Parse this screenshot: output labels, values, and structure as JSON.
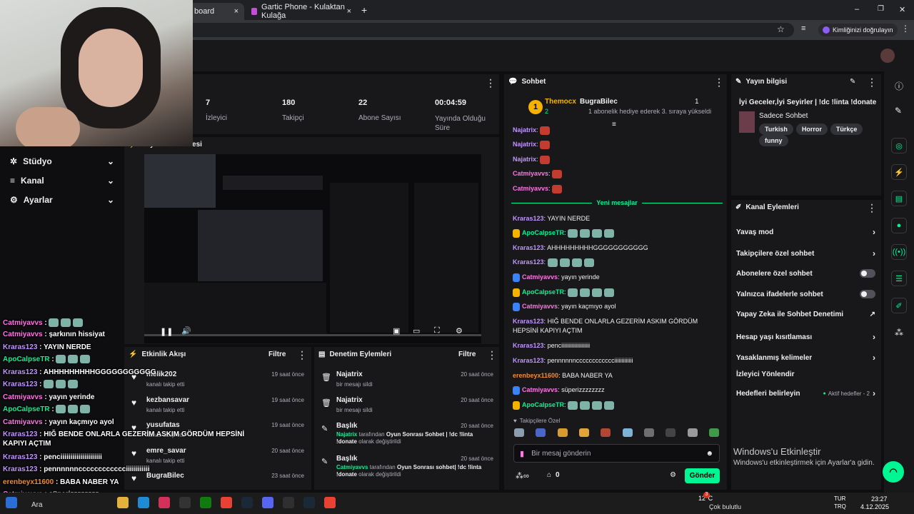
{
  "browser": {
    "tabs": [
      {
        "label": "board",
        "close": "×"
      },
      {
        "label": "Gartic Phone - Kulaktan Kulağa",
        "close": "×"
      }
    ],
    "new_tab": "+",
    "profile_label": "Kimliğinizi doğrulayın",
    "win_min": "–",
    "win_max": "❐",
    "win_close": "✕"
  },
  "stats": [
    {
      "value": "7",
      "label": "İzleyici"
    },
    {
      "value": "180",
      "label": "Takipçi"
    },
    {
      "value": "22",
      "label": "Abone Sayısı"
    },
    {
      "value": "00:04:59",
      "label": "Yayında Olduğu Süre"
    }
  ],
  "preview_title": "Yayın Ön İzlemesi",
  "sidebar": {
    "items": [
      {
        "label": "Stüdyo"
      },
      {
        "label": "Kanal"
      },
      {
        "label": "Ayarlar"
      }
    ]
  },
  "activity": {
    "title": "Etkinlik Akışı",
    "filter": "Filtre",
    "items": [
      {
        "name": "melik202",
        "action": "kanalı takip etti",
        "time": "19 saat önce"
      },
      {
        "name": "kezbansavar",
        "action": "kanalı takip etti",
        "time": "19 saat önce"
      },
      {
        "name": "yusufatas",
        "action": "kanalı takip etti",
        "time": "19 saat önce"
      },
      {
        "name": "emre_savar",
        "action": "kanalı takip etti",
        "time": "20 saat önce"
      },
      {
        "name": "BugraBilec",
        "action": "",
        "time": "23 saat önce"
      }
    ]
  },
  "moderation": {
    "title": "Denetim Eylemleri",
    "filter": "Filtre",
    "items": [
      {
        "name": "Najatrix",
        "detail": "bir mesajı sildi",
        "time": "20 saat önce"
      },
      {
        "name": "Najatrix",
        "detail": "bir mesajı sildi",
        "time": "20 saat önce"
      },
      {
        "name": "Başlık",
        "user": "Najatrix",
        "mid": "tarafından",
        "value": "Oyun Sonrası Sohbet | !dc !linta !donate",
        "tail": "olarak değiştirildi",
        "time": "20 saat önce"
      },
      {
        "name": "Başlık",
        "user": "Catmiyavvs",
        "mid": "tarafından",
        "value": "Oyun Sonrası sohbet| !dc !linta !donate",
        "tail": "olarak değiştirildi",
        "time": "20 saat önce"
      }
    ]
  },
  "chat": {
    "title": "Sohbet",
    "leader": {
      "rank": "1",
      "name": "Themocx",
      "count": "2"
    },
    "gift": {
      "name": "BugraBilec",
      "count": "1",
      "text": "1 abonelik hediye ederek 3. sıraya yükseldi"
    },
    "new_messages": "Yeni mesajlar",
    "messages_before": [
      {
        "user": "Najatrix",
        "text": ""
      },
      {
        "user": "Najatrix",
        "text": ""
      },
      {
        "user": "Najatrix",
        "text": ""
      },
      {
        "user": "Catmiyavvs",
        "text": ""
      },
      {
        "user": "Catmiyavvs",
        "text": ""
      }
    ],
    "messages": [
      {
        "user": "Kraras123",
        "text": "YAYIN NERDE"
      },
      {
        "user": "ApoCalpseTR",
        "text": ""
      },
      {
        "user": "Kraras123",
        "text": "AHHHHHHHHHGGGGGGGGGGG"
      },
      {
        "user": "Kraras123",
        "text": ""
      },
      {
        "user": "Catmiyavvs",
        "text": "yayın yerinde"
      },
      {
        "user": "ApoCalpseTR",
        "text": ""
      },
      {
        "user": "Catmiyavvs",
        "text": "yayın kaçmıyo ayol"
      },
      {
        "user": "Kraras123",
        "text": "HIĞ BENDE ONLARLA GEZERİM ASKIM GÖRDÜM HEPSİNİ KAPIYI AÇTIM"
      },
      {
        "user": "Kraras123",
        "text": "penciiiiiiiiiiiiiiiiiiii"
      },
      {
        "user": "Kraras123",
        "text": "pennnnnncccccccccccciiiiiiiiiiiii"
      },
      {
        "user": "erenbeyx11600",
        "text": "BABA NABER YA"
      },
      {
        "user": "Catmiyavvs",
        "text": "süperizzzzzzzz"
      },
      {
        "user": "ApoCalpseTR",
        "text": ""
      }
    ],
    "emote_section": "Takipçilere Özel",
    "input_placeholder": "Bir mesaj gönderin",
    "points": "0",
    "send": "Gönder"
  },
  "stream_info": {
    "title": "Yayın bilgisi",
    "stream_title": "İyi Geceler,İyi Seyirler | !dc !linta !donate",
    "category": "Sadece Sohbet",
    "tags": [
      "Turkish",
      "Horror",
      "Türkçe",
      "funny"
    ]
  },
  "channel_actions": {
    "title": "Kanal Eylemleri",
    "items": [
      {
        "label": "Yavaş mod",
        "control": "chevron"
      },
      {
        "label": "Takipçilere özel sohbet",
        "control": "chevron"
      },
      {
        "label": "Abonelere özel sohbet",
        "control": "toggle"
      },
      {
        "label": "Yalnızca ifadelerle sohbet",
        "control": "toggle"
      },
      {
        "label": "Yapay Zeka ile Sohbet Denetimi",
        "control": "external"
      },
      {
        "label": "Hesap yaşı kısıtlaması",
        "control": "chevron"
      },
      {
        "label": "Yasaklanmış kelimeler",
        "control": "chevron"
      },
      {
        "label": "İzleyici Yönlendir",
        "control": "none"
      },
      {
        "label": "Hedefleri belirleyin",
        "control": "chevron",
        "badge": "Aktif hedefler - 2"
      }
    ]
  },
  "overlay_chat": [
    {
      "user": "Catmiyavvs",
      "text": ""
    },
    {
      "user": "Catmiyavvs",
      "text": "şarkının hissiyat"
    },
    {
      "user": "Kraras123",
      "text": "YAYIN NERDE"
    },
    {
      "user": "ApoCalpseTR",
      "text": ""
    },
    {
      "user": "Kraras123",
      "text": "AHHHHHHHHHGGGGGGGGGGG"
    },
    {
      "user": "Kraras123",
      "text": ""
    },
    {
      "user": "Catmiyavvs",
      "text": "yayın yerinde"
    },
    {
      "user": "ApoCalpseTR",
      "text": ""
    },
    {
      "user": "Catmiyavvs",
      "text": "yayın kaçmıyo ayol"
    },
    {
      "user": "Kraras123",
      "text": "HIĞ BENDE ONLARLA GEZERİM ASKIM GÖRDÜM HEPSİNİ KAPIYI AÇTIM"
    },
    {
      "user": "Kraras123",
      "text": "penciiiiiiiiiiiiiiiiiiiii"
    },
    {
      "user": "Kraras123",
      "text": "pennnnnncccccccccccciiiiiiiiiiii"
    },
    {
      "user": "erenbeyx11600",
      "text": "BABA NABER YA"
    },
    {
      "user": "Catmiyavvs",
      "text": "süperizzzzzzzz"
    }
  ],
  "windows": {
    "watermark_title": "Windows'u Etkinleştir",
    "watermark_sub": "Windows'u etkinleştirmek için Ayarlar'a gidin.",
    "search": "Ara",
    "weather_temp": "12°C",
    "weather_desc": "Çok bulutlu",
    "weather_badge": "3",
    "lang1": "TUR",
    "lang2": "TRQ",
    "time": "23:27",
    "date": "4.12.2025"
  },
  "colors": {
    "accent": "#00f593",
    "purple": "#bf94ff",
    "pink": "#ff75e6",
    "bg": "#0e0e10",
    "panel": "#18181b"
  }
}
